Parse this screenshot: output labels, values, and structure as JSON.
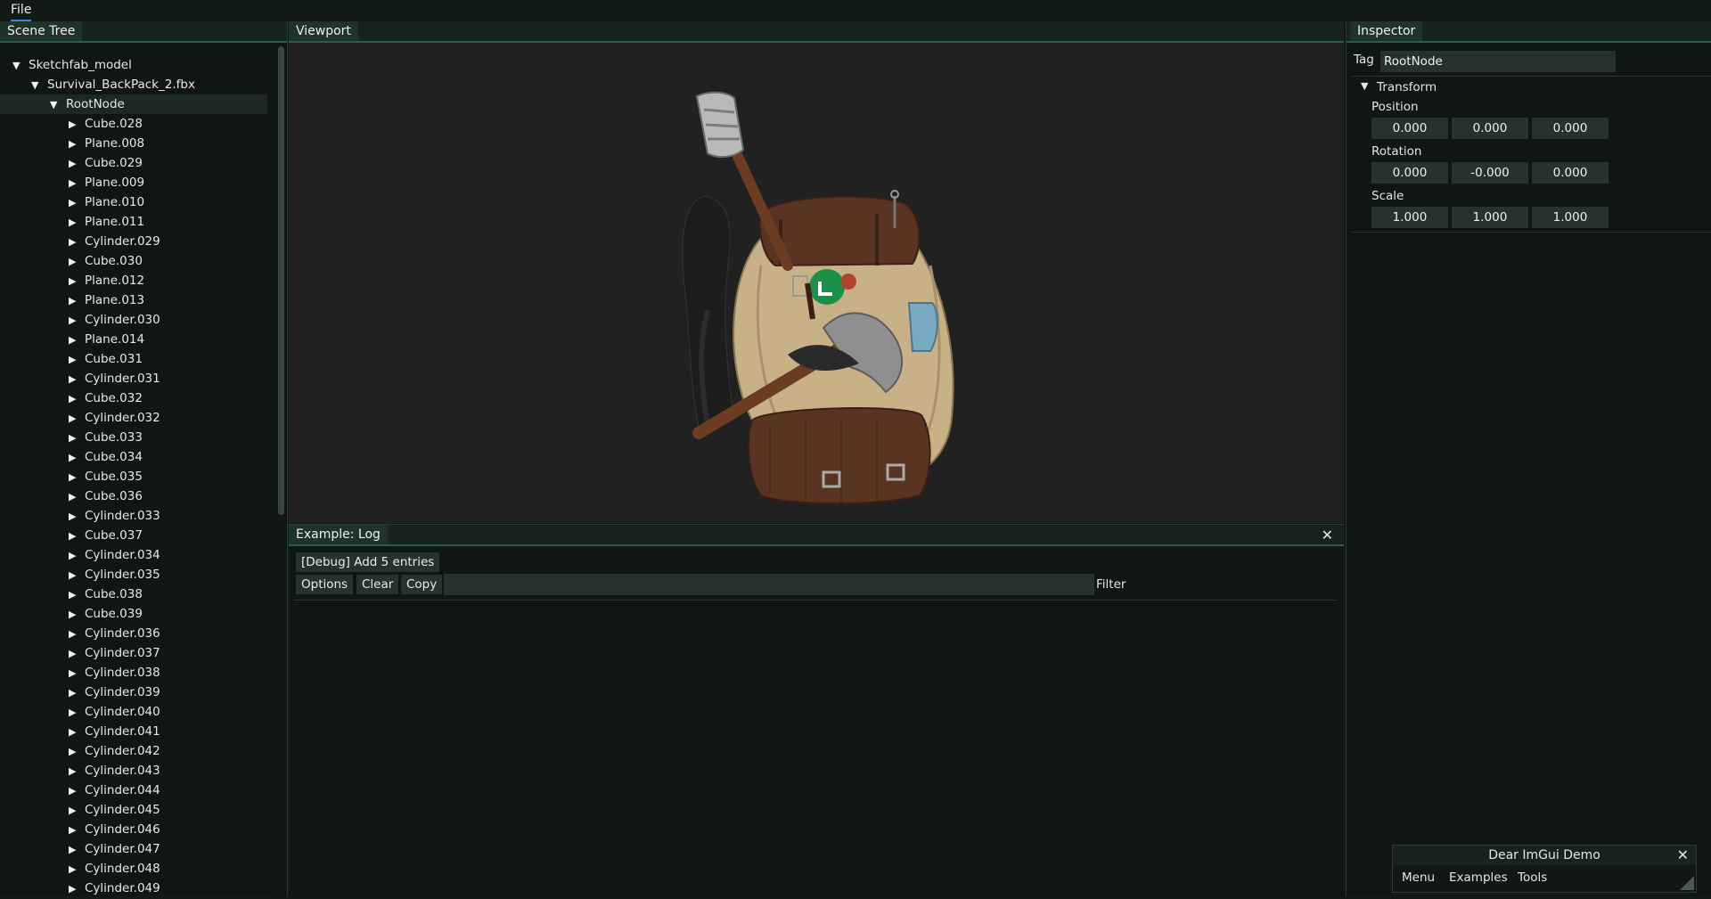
{
  "menubar": {
    "file_label": "File"
  },
  "scene_tree": {
    "tab_label": "Scene Tree",
    "items": [
      {
        "label": "Sketchfab_model",
        "depth": 0
      },
      {
        "label": "Survival_BackPack_2.fbx",
        "depth": 1
      },
      {
        "label": "RootNode",
        "depth": 2,
        "selected": true
      },
      {
        "label": "Cube.028",
        "depth": 3
      },
      {
        "label": "Plane.008",
        "depth": 3
      },
      {
        "label": "Cube.029",
        "depth": 3
      },
      {
        "label": "Plane.009",
        "depth": 3
      },
      {
        "label": "Plane.010",
        "depth": 3
      },
      {
        "label": "Plane.011",
        "depth": 3
      },
      {
        "label": "Cylinder.029",
        "depth": 3
      },
      {
        "label": "Cube.030",
        "depth": 3
      },
      {
        "label": "Plane.012",
        "depth": 3
      },
      {
        "label": "Plane.013",
        "depth": 3
      },
      {
        "label": "Cylinder.030",
        "depth": 3
      },
      {
        "label": "Plane.014",
        "depth": 3
      },
      {
        "label": "Cube.031",
        "depth": 3
      },
      {
        "label": "Cylinder.031",
        "depth": 3
      },
      {
        "label": "Cube.032",
        "depth": 3
      },
      {
        "label": "Cylinder.032",
        "depth": 3
      },
      {
        "label": "Cube.033",
        "depth": 3
      },
      {
        "label": "Cube.034",
        "depth": 3
      },
      {
        "label": "Cube.035",
        "depth": 3
      },
      {
        "label": "Cube.036",
        "depth": 3
      },
      {
        "label": "Cylinder.033",
        "depth": 3
      },
      {
        "label": "Cube.037",
        "depth": 3
      },
      {
        "label": "Cylinder.034",
        "depth": 3
      },
      {
        "label": "Cylinder.035",
        "depth": 3
      },
      {
        "label": "Cube.038",
        "depth": 3
      },
      {
        "label": "Cube.039",
        "depth": 3
      },
      {
        "label": "Cylinder.036",
        "depth": 3
      },
      {
        "label": "Cylinder.037",
        "depth": 3
      },
      {
        "label": "Cylinder.038",
        "depth": 3
      },
      {
        "label": "Cylinder.039",
        "depth": 3
      },
      {
        "label": "Cylinder.040",
        "depth": 3
      },
      {
        "label": "Cylinder.041",
        "depth": 3
      },
      {
        "label": "Cylinder.042",
        "depth": 3
      },
      {
        "label": "Cylinder.043",
        "depth": 3
      },
      {
        "label": "Cylinder.044",
        "depth": 3
      },
      {
        "label": "Cylinder.045",
        "depth": 3
      },
      {
        "label": "Cylinder.046",
        "depth": 3
      },
      {
        "label": "Cylinder.047",
        "depth": 3
      },
      {
        "label": "Cylinder.048",
        "depth": 3
      },
      {
        "label": "Cylinder.049",
        "depth": 3
      }
    ]
  },
  "viewport": {
    "tab_label": "Viewport"
  },
  "log": {
    "tab_label": "Example: Log",
    "debug_button": "[Debug] Add 5 entries",
    "options_button": "Options",
    "clear_button": "Clear",
    "copy_button": "Copy",
    "filter_value": "",
    "filter_label": "Filter"
  },
  "inspector": {
    "tab_label": "Inspector",
    "tag_label": "Tag",
    "tag_value": "RootNode",
    "transform_label": "Transform",
    "position_label": "Position",
    "position": [
      "0.000",
      "0.000",
      "0.000"
    ],
    "rotation_label": "Rotation",
    "rotation": [
      "0.000",
      "-0.000",
      "0.000"
    ],
    "scale_label": "Scale",
    "scale": [
      "1.000",
      "1.000",
      "1.000"
    ]
  },
  "imgui_demo": {
    "title": "Dear ImGui Demo",
    "menu": [
      "Menu",
      "Examples",
      "Tools"
    ]
  },
  "colors": {
    "background": "#121a15",
    "viewport_background": "#212121",
    "tab_active": "#20332a",
    "tab_underline": "#2c5d47",
    "field": "#25332c",
    "menu_underline": "#3c86c9"
  }
}
